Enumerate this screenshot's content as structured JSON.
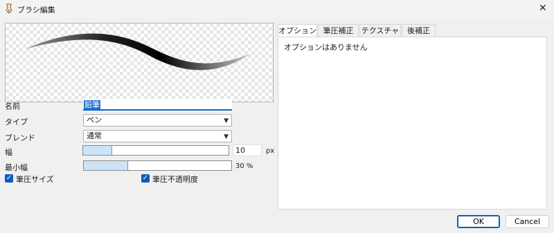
{
  "window": {
    "title": "ブラシ編集",
    "close_glyph": "✕"
  },
  "form": {
    "name_label": "名前",
    "name_value": "鉛筆",
    "type_label": "タイプ",
    "type_value": "ペン",
    "blend_label": "ブレンド",
    "blend_value": "通常",
    "width_label": "幅",
    "width_value": "10",
    "width_unit": "px",
    "width_fill_fraction": 0.2,
    "minwidth_label": "最小幅",
    "minwidth_text": "30 %",
    "minwidth_fill_fraction": 0.3,
    "pressure_size_label": "筆圧サイズ",
    "pressure_size_checked": true,
    "pressure_opacity_label": "筆圧不透明度",
    "pressure_opacity_checked": true,
    "check_glyph": "✓",
    "dropdown_glyph": "▼"
  },
  "tabs": [
    {
      "label": "オプション",
      "active": true
    },
    {
      "label": "筆圧補正",
      "active": false
    },
    {
      "label": "テクスチャ",
      "active": false
    },
    {
      "label": "後補正",
      "active": false
    }
  ],
  "tab_panel": {
    "message": "オプションはありません"
  },
  "buttons": {
    "ok": "OK",
    "cancel": "Cancel"
  },
  "colors": {
    "accent": "#0b5cbd",
    "slider_fill": "#cce4f7"
  }
}
